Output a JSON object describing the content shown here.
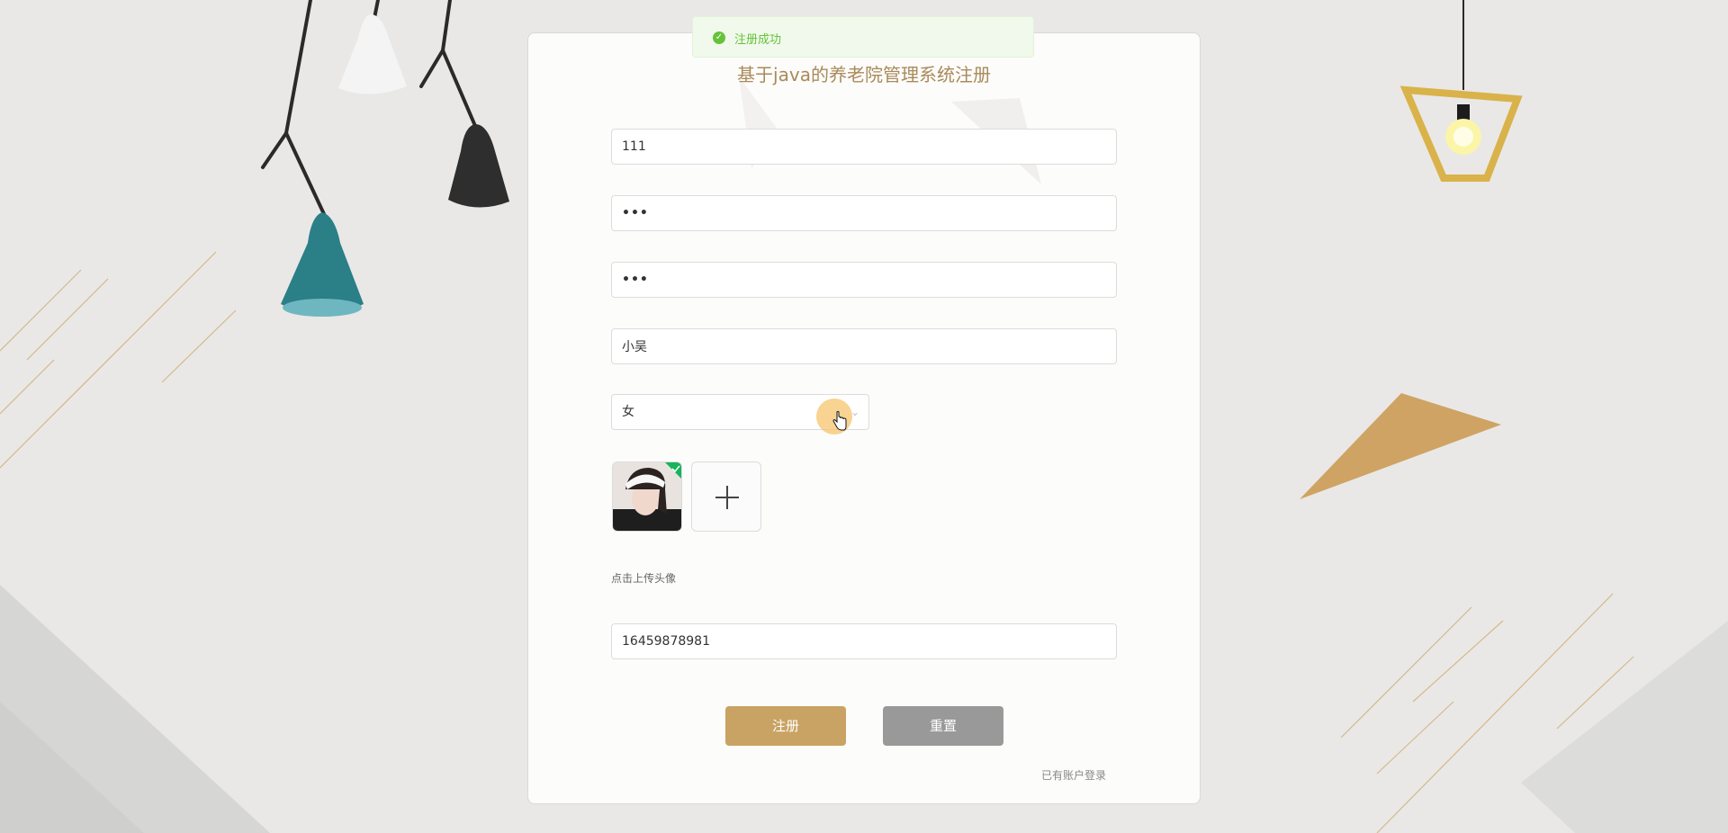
{
  "toast": {
    "message": "注册成功",
    "icon": "check-circle-icon",
    "color": "#67c23a"
  },
  "form": {
    "title": "基于java的养老院管理系统注册",
    "account_value": "111",
    "password_value": "•••",
    "confirm_password_value": "•••",
    "name_value": "小吴",
    "gender_value": "女",
    "avatar_hint": "点击上传头像",
    "phone_value": "16459878981",
    "register_label": "注册",
    "reset_label": "重置",
    "login_link": "已有账户登录"
  },
  "colors": {
    "accent": "#c9a363",
    "title": "#a98a5a",
    "reset": "#999999",
    "background": "#e9e8e6"
  }
}
